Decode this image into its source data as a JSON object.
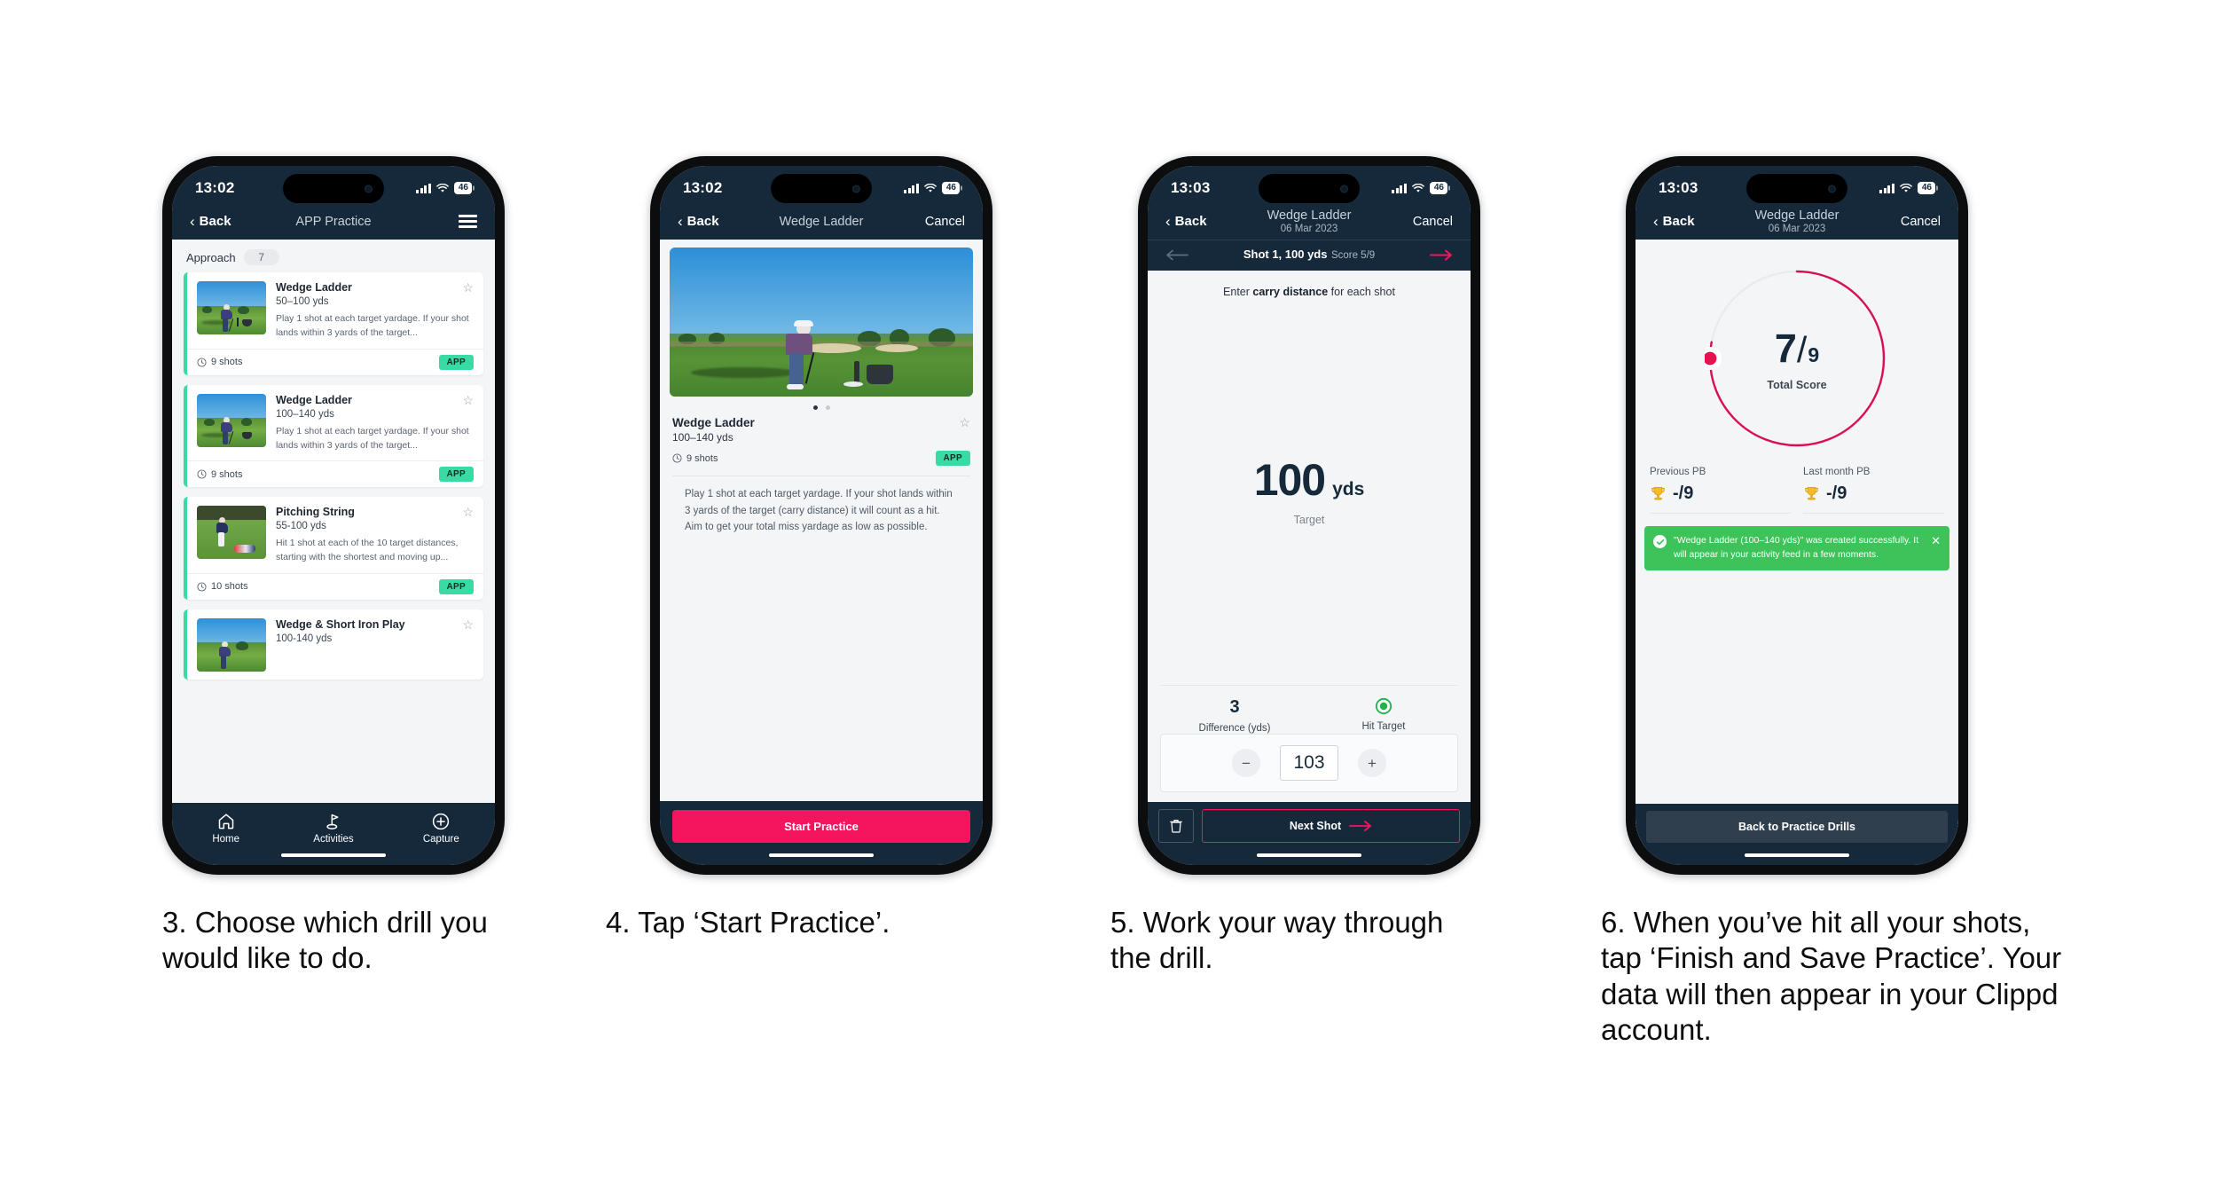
{
  "phones": [
    {
      "status": {
        "time": "13:02",
        "battery": "46",
        "signal_icon": "cellular-signal-icon",
        "wifi_icon": "wifi-icon"
      },
      "nav": {
        "back": "Back",
        "title": "APP Practice",
        "menu_icon": "hamburger-menu-icon"
      },
      "category": {
        "label": "Approach",
        "count": "7"
      },
      "cards": [
        {
          "title": "Wedge Ladder",
          "yardage": "50–100 yds",
          "desc": "Play 1 shot at each target yardage. If your shot lands within 3 yards of the target...",
          "shots": "9 shots",
          "tag": "APP",
          "star_icon": "star-outline-icon",
          "clock_icon": "clock-icon"
        },
        {
          "title": "Wedge Ladder",
          "yardage": "100–140 yds",
          "desc": "Play 1 shot at each target yardage. If your shot lands within 3 yards of the target...",
          "shots": "9 shots",
          "tag": "APP",
          "star_icon": "star-outline-icon",
          "clock_icon": "clock-icon"
        },
        {
          "title": "Pitching String",
          "yardage": "55-100 yds",
          "desc": "Hit 1 shot at each of the 10 target distances, starting with the shortest and moving up...",
          "shots": "10 shots",
          "tag": "APP",
          "star_icon": "star-outline-icon",
          "clock_icon": "clock-icon"
        },
        {
          "title": "Wedge & Short Iron Play",
          "yardage": "100-140 yds",
          "desc": "",
          "shots": "",
          "tag": "",
          "star_icon": "star-outline-icon",
          "clock_icon": "clock-icon"
        }
      ],
      "tabs": [
        {
          "label": "Home",
          "icon": "home-icon"
        },
        {
          "label": "Activities",
          "icon": "golf-flag-icon"
        },
        {
          "label": "Capture",
          "icon": "plus-circle-icon"
        }
      ]
    },
    {
      "status": {
        "time": "13:02",
        "battery": "46"
      },
      "nav": {
        "back": "Back",
        "title": "Wedge Ladder",
        "cancel": "Cancel"
      },
      "carousel": {
        "dots": 2,
        "active": 0
      },
      "title": "Wedge Ladder",
      "yardage": "100–140 yds",
      "shots": "9 shots",
      "tag": "APP",
      "star_icon": "star-outline-icon",
      "desc": "Play 1 shot at each target yardage. If your shot lands within 3 yards of the target (carry distance) it will count as a hit. Aim to get your total miss yardage as low as possible.",
      "cta": "Start Practice"
    },
    {
      "status": {
        "time": "13:03",
        "battery": "46"
      },
      "nav": {
        "back": "Back",
        "title": "Wedge Ladder",
        "date": "06 Mar 2023",
        "cancel": "Cancel"
      },
      "shotbar": {
        "shot": "Shot 1, 100 yds",
        "score": "Score 5/9",
        "prev_icon": "arrow-left-icon",
        "next_icon": "arrow-right-icon"
      },
      "prompt_pre": "Enter ",
      "prompt_bold": "carry distance",
      "prompt_post": " for each shot",
      "big_value": "100",
      "big_unit": "yds",
      "big_label": "Target",
      "stats": [
        {
          "value": "3",
          "label": "Difference (yds)"
        },
        {
          "value": "",
          "label": "Hit Target",
          "icon": "hit-target-radio-icon"
        }
      ],
      "stepper": {
        "minus": "−",
        "value": "103",
        "plus": "+"
      },
      "footer": {
        "delete_icon": "trash-icon",
        "next": "Next Shot",
        "next_icon": "arrow-right-icon"
      }
    },
    {
      "status": {
        "time": "13:03",
        "battery": "46"
      },
      "nav": {
        "back": "Back",
        "title": "Wedge Ladder",
        "date": "06 Mar 2023",
        "cancel": "Cancel"
      },
      "ring": {
        "score": "7",
        "slash": "/",
        "total": "9",
        "label": "Total Score",
        "percent": 78,
        "color": "#d80f53",
        "track": "#e9ebee"
      },
      "pbs": [
        {
          "label": "Previous PB",
          "value": "-/9",
          "icon": "trophy-icon"
        },
        {
          "label": "Last month PB",
          "value": "-/9",
          "icon": "trophy-icon"
        }
      ],
      "toast": {
        "message": "\"Wedge Ladder (100–140 yds)\" was created successfully. It will appear in your activity feed in a few moments.",
        "check_icon": "check-circle-icon",
        "close_icon": "close-icon",
        "color": "#3ec35a"
      },
      "footer_button": "Back to Practice Drills"
    }
  ],
  "captions": [
    "3. Choose which drill you would like to do.",
    "4. Tap ‘Start Practice’.",
    "5. Work your way through the drill.",
    "6. When you’ve hit all your shots, tap ‘Finish and Save Practice’. Your data will then appear in your Clippd account."
  ],
  "colors": {
    "navy": "#16293a",
    "pink": "#f5145e",
    "mint": "#39dba4",
    "green": "#3ec35a",
    "crimson": "#d80f53"
  }
}
